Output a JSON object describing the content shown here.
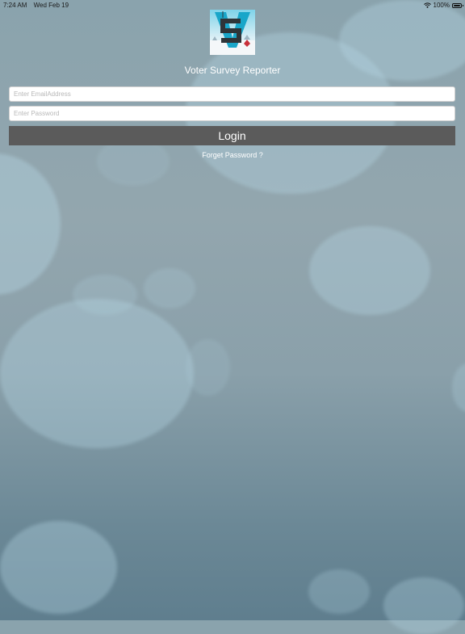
{
  "status_bar": {
    "time": "7:24 AM",
    "date": "Wed Feb 19",
    "battery_percent": "100%",
    "wifi_icon": "wifi-icon",
    "battery_icon": "battery-icon"
  },
  "app": {
    "logo_icon": "voter-survey-logo",
    "title": "Voter Survey Reporter"
  },
  "form": {
    "email_placeholder": "Enter EmailAddress",
    "email_value": "",
    "password_placeholder": "Enter Password",
    "password_value": "",
    "login_label": "Login",
    "forgot_label": "Forget Password ?"
  },
  "colors": {
    "login_button": "#5b5b5b",
    "background_top": "#8aa3ad",
    "background_bottom": "#5f7e8e",
    "bokeh": "#b7d8e6"
  }
}
